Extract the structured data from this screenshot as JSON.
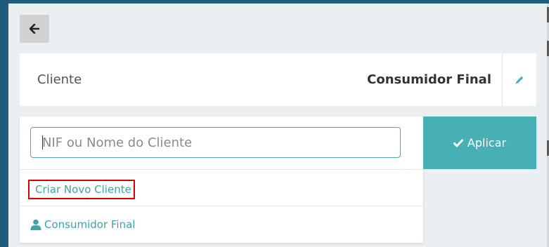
{
  "client": {
    "label": "Cliente",
    "value": "Consumidor Final"
  },
  "search": {
    "placeholder": "NIF ou Nome do Cliente",
    "value": ""
  },
  "apply_button": {
    "label": "Aplicar"
  },
  "results": {
    "create_label": "Criar Novo Cliente",
    "consumer_label": "Consumidor Final"
  },
  "icons": {
    "back": "arrow-left-icon",
    "edit": "pencil-icon",
    "apply": "check-icon",
    "create": "plus-circle-icon",
    "consumer": "user-icon"
  },
  "colors": {
    "accent": "#47b0b4",
    "link": "#3fa3a8",
    "highlight_border": "#d40000",
    "sidebar": "#1f5b7a"
  }
}
